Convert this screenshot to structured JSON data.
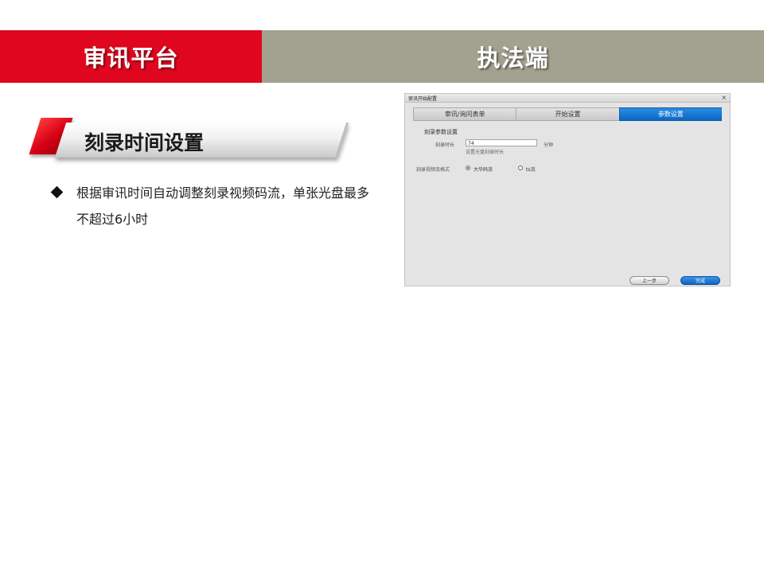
{
  "banner": {
    "left_title": "审讯平台",
    "right_title": "执法端",
    "left_color": "#e0061f",
    "right_color": "#a3a290"
  },
  "section": {
    "title": "刻录时间设置"
  },
  "bullet": {
    "text": "根据审讯时间自动调整刻录视频码流，单张光盘最多不超过6小时"
  },
  "dialog": {
    "title": "审讯开始配置",
    "close_glyph": "×",
    "tabs": [
      {
        "label": "审讯/询问表单"
      },
      {
        "label": "开始设置"
      },
      {
        "label": "参数设置"
      }
    ],
    "active_tab": "参数设置",
    "group_label": "刻录参数设置",
    "duration_label": "刻录时长",
    "duration_value": "74",
    "duration_unit": "分钟",
    "duration_hint": "设置光盘刻录时长",
    "format_label": "刻录视频流格式",
    "format_options": [
      {
        "label": "大华码流",
        "checked": true
      },
      {
        "label": "ts流",
        "checked": false
      }
    ],
    "prev_button": "上一步",
    "done_button": "完成",
    "accent_color": "#0b66c2"
  }
}
